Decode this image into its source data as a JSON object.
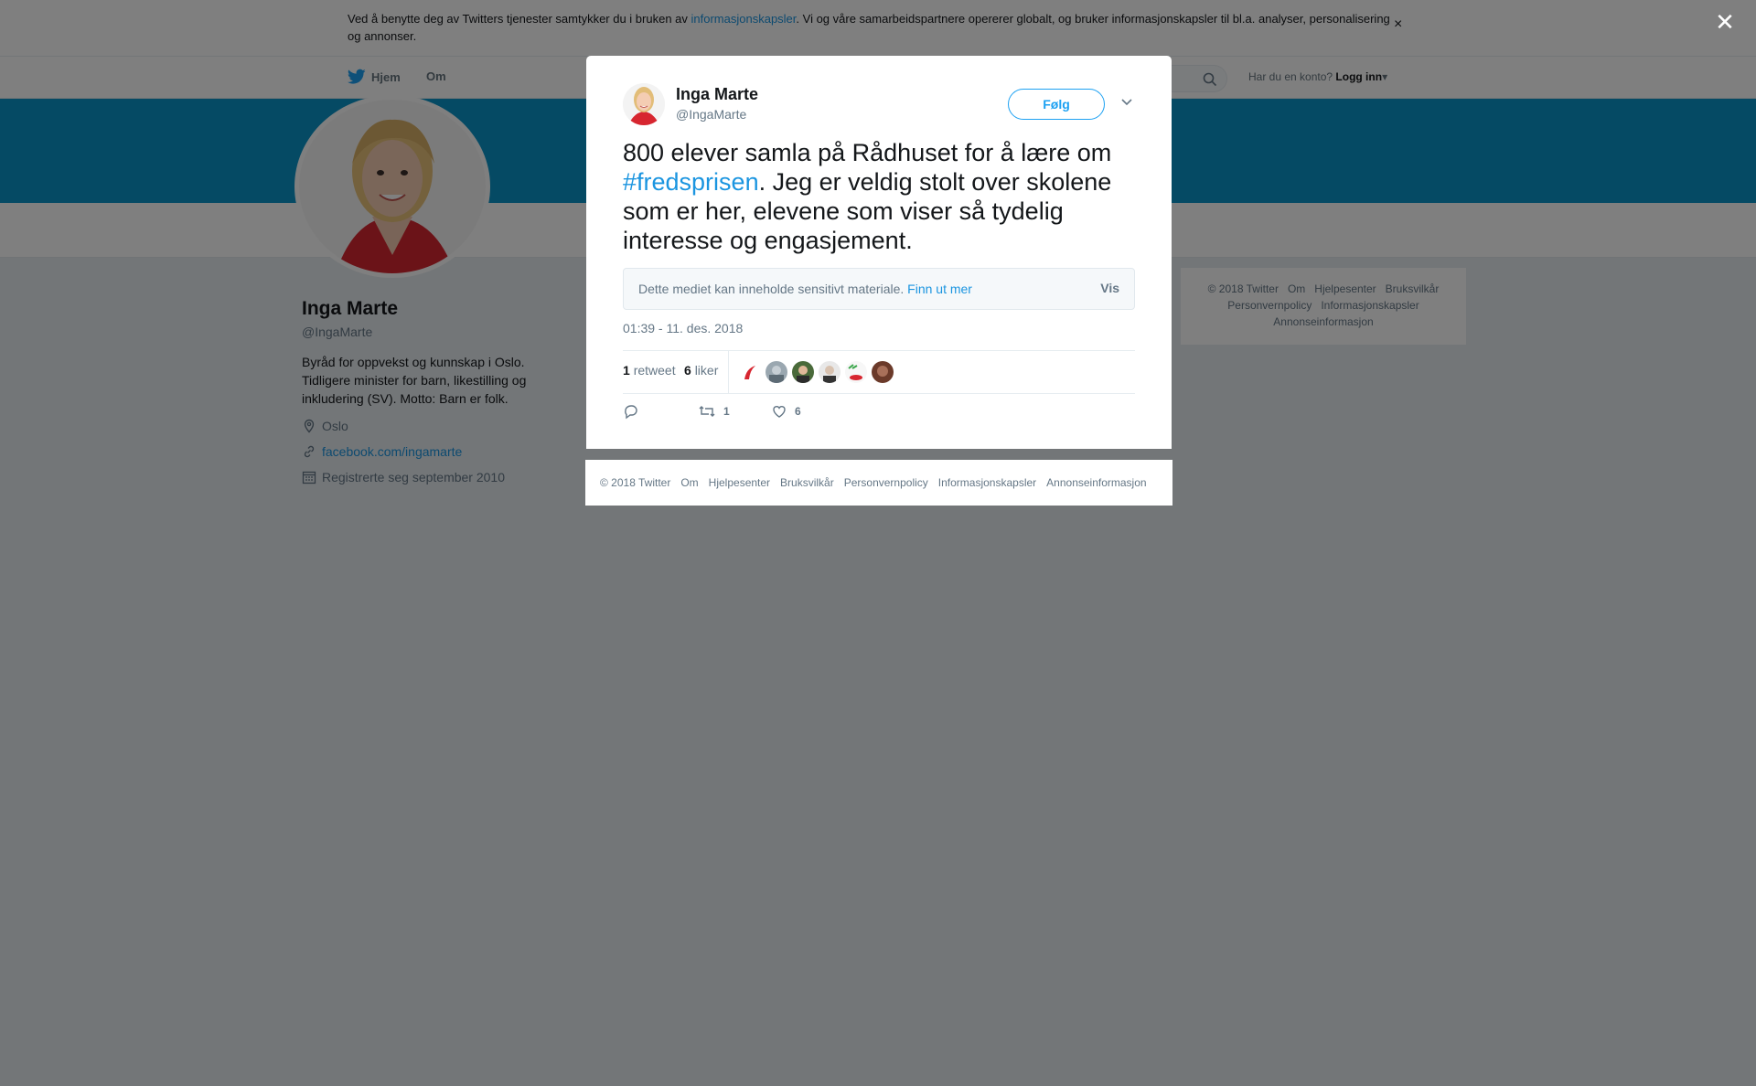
{
  "cookie": {
    "text_before": "Ved å benytte deg av Twitters tjenester samtykker du i bruken av ",
    "link": "informasjonskapsler",
    "text_after": ". Vi og våre samarbeidspartnere opererer globalt, og bruker informasjonskapsler til bl.a. analyser, personalisering og annonser.",
    "close": "×"
  },
  "nav": {
    "home": "Hjem",
    "about": "Om",
    "login_prompt": "Har du en konto?",
    "login": "Logg inn"
  },
  "profile": {
    "name": "Inga Marte",
    "handle": "@IngaMarte",
    "bio": "Byråd for oppvekst og kunnskap i Oslo. Tidligere minister for barn, likestilling og inkludering (SV). Motto: Barn er folk.",
    "location": "Oslo",
    "website": "facebook.com/ingamarte",
    "joined": "Registrerte seg september 2010"
  },
  "side_footer": {
    "items": [
      "© 2018 Twitter",
      "Om",
      "Hjelpesenter",
      "Bruksvilkår",
      "Personvernpolicy",
      "Informasjonskapsler",
      "Annonseinformasjon"
    ]
  },
  "modal": {
    "name": "Inga Marte",
    "handle": "@IngaMarte",
    "follow": "Følg",
    "text_1": "800 elever samla på Rådhuset for å lære om ",
    "hashtag": "#fredsprisen",
    "text_2": ". Jeg er veldig stolt over skolene som er her, elevene som viser så tydelig interesse og engasjement.",
    "sensitive_text": "Dette mediet kan inneholde sensitivt materiale. ",
    "sensitive_link": "Finn ut mer",
    "sensitive_show": "Vis",
    "timestamp": "01:39 - 11. des. 2018",
    "retweet_count": "1",
    "retweet_label": "retweet",
    "like_count": "6",
    "like_label": "liker",
    "action_retweets": "1",
    "action_likes": "6"
  },
  "modal_footer": {
    "items": [
      "© 2018 Twitter",
      "Om",
      "Hjelpesenter",
      "Bruksvilkår",
      "Personvernpolicy",
      "Informasjonskapsler",
      "Annonseinformasjon"
    ]
  },
  "colors": {
    "accent": "#1da1f2",
    "link": "#1b95e0",
    "banner": "#0a95c8"
  }
}
